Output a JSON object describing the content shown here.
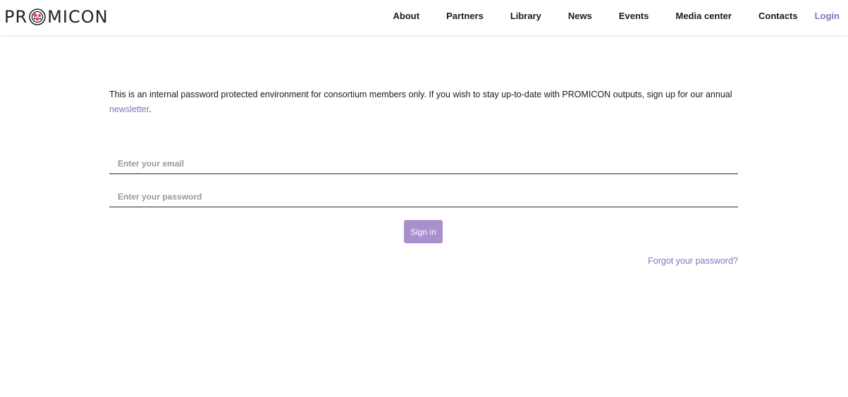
{
  "brand": {
    "logo_prefix": "PR",
    "logo_suffix": "MICON",
    "logo_icon": "promicon-o-icon"
  },
  "nav": {
    "items": [
      {
        "label": "About"
      },
      {
        "label": "Partners"
      },
      {
        "label": "Library"
      },
      {
        "label": "News"
      },
      {
        "label": "Events"
      },
      {
        "label": "Media center"
      },
      {
        "label": "Contacts"
      },
      {
        "label": "Login",
        "active": true
      }
    ]
  },
  "intro": {
    "text_before_link": "This is an internal password protected environment for consortium members only. If you wish to stay up-to-date with PROMICON outputs, sign up for our annual ",
    "link_text": "newsletter",
    "text_after_link": "."
  },
  "form": {
    "email_placeholder": "Enter your email",
    "password_placeholder": "Enter your password",
    "signin_label": "Sign in",
    "forgot_label": "Forgot your password?"
  },
  "colors": {
    "accent": "#8a70bd",
    "button_bg": "#a88fcd",
    "text": "#1a1a1a"
  }
}
